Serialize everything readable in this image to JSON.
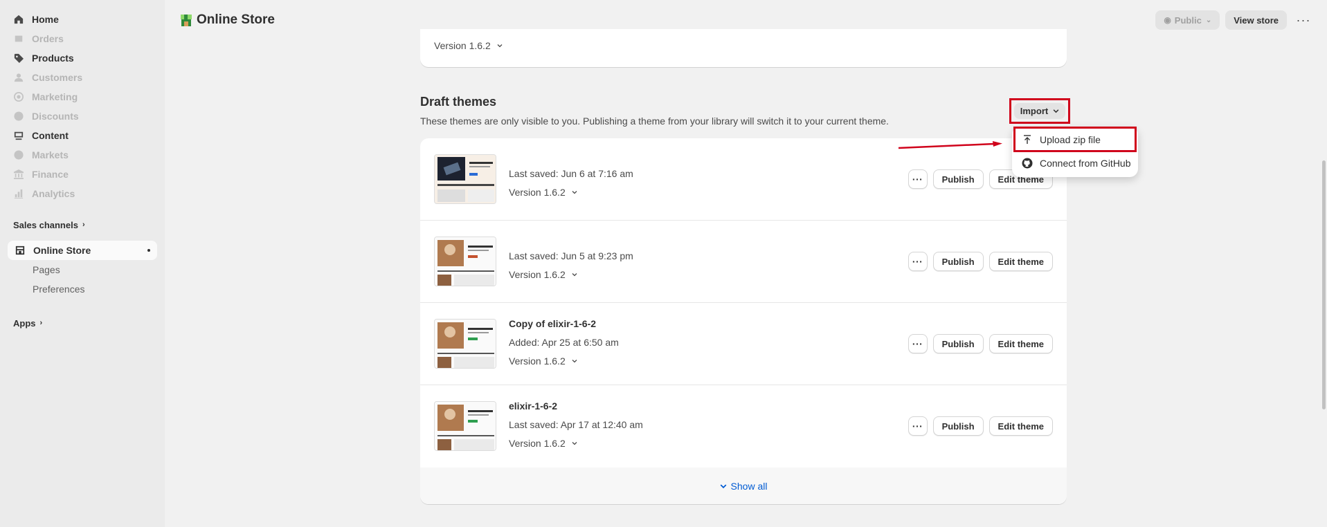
{
  "sidebar": {
    "nav": [
      {
        "label": "Home",
        "icon": "home-icon",
        "disabled": false
      },
      {
        "label": "Orders",
        "icon": "orders-icon",
        "disabled": true
      },
      {
        "label": "Products",
        "icon": "tag-icon",
        "disabled": false
      },
      {
        "label": "Customers",
        "icon": "person-icon",
        "disabled": true
      },
      {
        "label": "Marketing",
        "icon": "target-icon",
        "disabled": true
      },
      {
        "label": "Discounts",
        "icon": "discount-icon",
        "disabled": true
      },
      {
        "label": "Content",
        "icon": "content-icon",
        "disabled": false
      },
      {
        "label": "Markets",
        "icon": "globe-icon",
        "disabled": true
      },
      {
        "label": "Finance",
        "icon": "bank-icon",
        "disabled": true
      },
      {
        "label": "Analytics",
        "icon": "chart-icon",
        "disabled": true
      }
    ],
    "sales_channels_label": "Sales channels",
    "online_store_label": "Online Store",
    "sub_items": [
      "Pages",
      "Preferences"
    ],
    "apps_label": "Apps"
  },
  "header": {
    "title": "Online Store",
    "public_label": "Public",
    "view_store_label": "View store",
    "more_label": "···"
  },
  "current_theme": {
    "version": "Version 1.6.2"
  },
  "draft": {
    "title": "Draft themes",
    "description": "These themes are only visible to you. Publishing a theme from your library will switch it to your current theme.",
    "import_label": "Import",
    "dropdown": {
      "upload_label": "Upload zip file",
      "github_label": "Connect from GitHub"
    },
    "themes": [
      {
        "name": "",
        "meta": "Last saved: Jun 6 at 7:16 am",
        "version": "Version 1.6.2"
      },
      {
        "name": "",
        "meta": "Last saved: Jun 5 at 9:23 pm",
        "version": "Version 1.6.2"
      },
      {
        "name": "Copy of elixir-1-6-2",
        "meta": "Added: Apr 25 at 6:50 am",
        "version": "Version 1.6.2"
      },
      {
        "name": "elixir-1-6-2",
        "meta": "Last saved: Apr 17 at 12:40 am",
        "version": "Version 1.6.2"
      }
    ],
    "publish_label": "Publish",
    "edit_label": "Edit theme",
    "dots_label": "···",
    "show_all_label": "Show all"
  },
  "colors": {
    "annotation": "#d0021b",
    "link": "#005bd3"
  }
}
